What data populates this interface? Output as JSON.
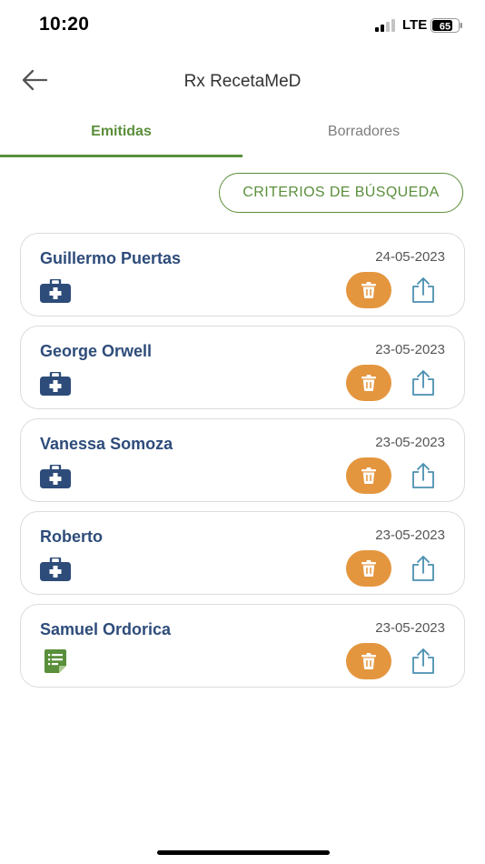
{
  "status_bar": {
    "time": "10:20",
    "network": "LTE",
    "battery": "65"
  },
  "header": {
    "title": "Rx RecetaMeD",
    "back_icon": "arrow-left-icon"
  },
  "tabs": [
    {
      "label": "Emitidas",
      "active": true
    },
    {
      "label": "Borradores",
      "active": false
    }
  ],
  "search_criteria_label": "CRITERIOS DE BÚSQUEDA",
  "colors": {
    "accent": "#5a8f3b",
    "name": "#2e4c7a",
    "delete": "#e4963f",
    "share": "#4a8fb0"
  },
  "prescriptions": [
    {
      "name": "Guillermo Puertas",
      "date": "24-05-2023",
      "icon": "medical-case-icon"
    },
    {
      "name": "George Orwell",
      "date": "23-05-2023",
      "icon": "medical-case-icon"
    },
    {
      "name": "Vanessa Somoza",
      "date": "23-05-2023",
      "icon": "medical-case-icon"
    },
    {
      "name": "Roberto",
      "date": "23-05-2023",
      "icon": "medical-case-icon"
    },
    {
      "name": "Samuel Ordorica",
      "date": "23-05-2023",
      "icon": "document-icon"
    }
  ]
}
